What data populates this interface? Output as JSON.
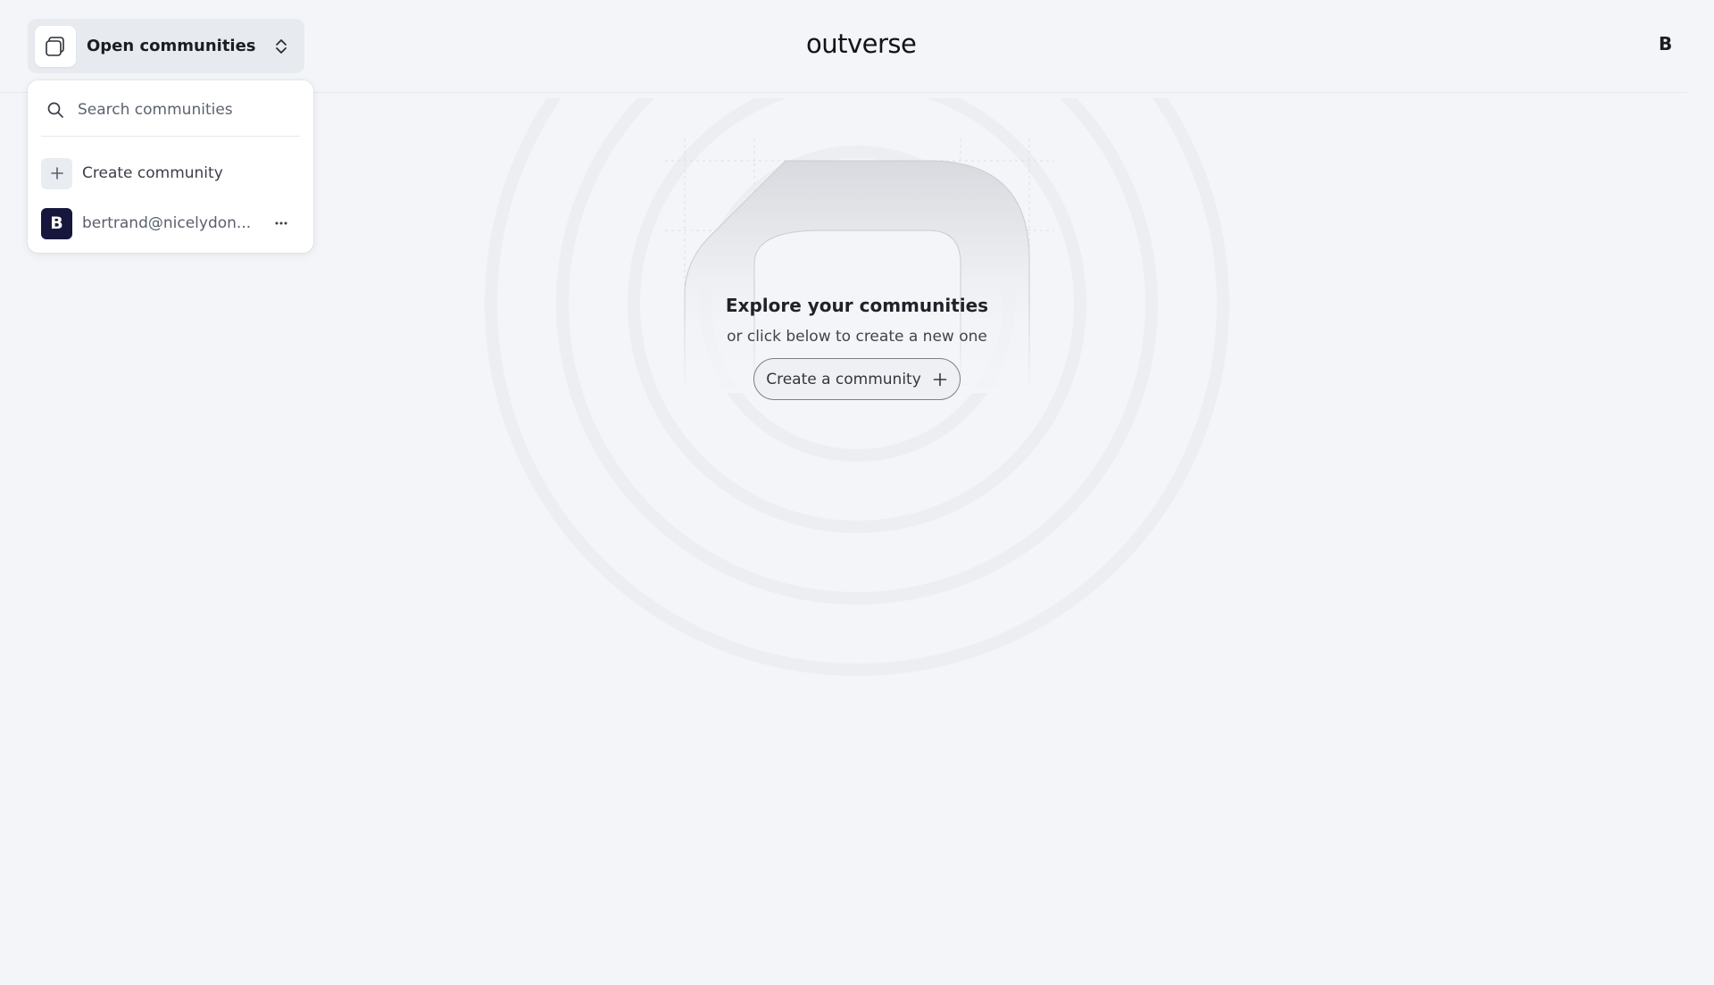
{
  "header": {
    "switcher_label": "Open communities",
    "switcher_icon": "stacked-squares-icon",
    "logo_text": "outverse",
    "user_initial": "B"
  },
  "dropdown": {
    "search_placeholder": "Search communities",
    "search_value": "",
    "create_label": "Create community",
    "account": {
      "avatar_initial": "B",
      "email": "bertrand@nicelydon...",
      "avatar_color": "#17173d"
    }
  },
  "hero": {
    "title": "Explore your communities",
    "subtitle": "or click below to create a new one",
    "button_label": "Create a community"
  },
  "colors": {
    "background": "#f3f5f8",
    "switcher_bg": "#e7eaee",
    "panel_bg": "#ffffff"
  }
}
